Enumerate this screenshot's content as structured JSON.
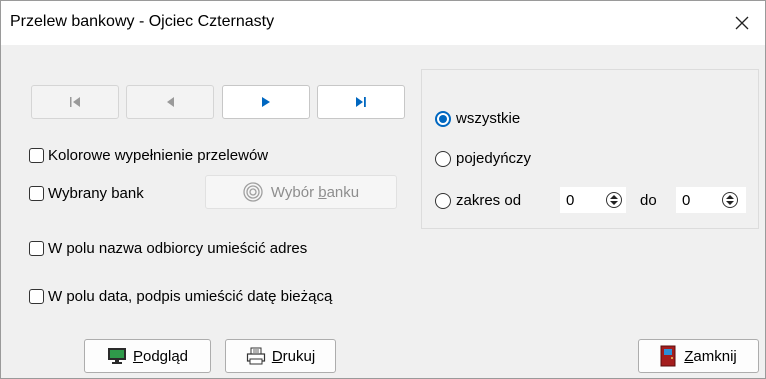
{
  "window": {
    "title": "Przelew bankowy - Ojciec Czternasty",
    "close_icon": "close-icon"
  },
  "navigation": {
    "first": {
      "icon": "first-record-icon",
      "enabled": false
    },
    "prev": {
      "icon": "previous-record-icon",
      "enabled": false
    },
    "next": {
      "icon": "next-record-icon",
      "enabled": true
    },
    "last": {
      "icon": "last-record-icon",
      "enabled": true
    }
  },
  "options": {
    "colored_fill": {
      "label": "Kolorowe wypełnienie przelewów",
      "checked": false
    },
    "selected_bank": {
      "label": "Wybrany bank",
      "checked": false
    },
    "bank_choice_button": {
      "label_pre": "Wybór ",
      "label_u": "b",
      "label_post": "anku",
      "enabled": false
    },
    "recipient_address": {
      "label": "W polu nazwa odbiorcy umieścić adres",
      "checked": false
    },
    "current_date": {
      "label": "W polu data, podpis umieścić datę bieżącą",
      "checked": false
    }
  },
  "range": {
    "all": {
      "label": "wszystkie",
      "selected": true
    },
    "single": {
      "label": "pojedyńczy",
      "selected": false
    },
    "range": {
      "label": "zakres od",
      "selected": false
    },
    "from_value": "0",
    "to_label": "do",
    "to_value": "0"
  },
  "buttons": {
    "preview": {
      "label_u": "P",
      "label_rest": "odgląd",
      "icon": "monitor-icon"
    },
    "print": {
      "label_u": "D",
      "label_rest": "rukuj",
      "icon": "printer-icon"
    },
    "close": {
      "label_u": "Z",
      "label_rest": "amknij",
      "icon": "door-exit-icon"
    }
  },
  "colors": {
    "accent": "#0067c0",
    "door": "#b01c1c"
  }
}
